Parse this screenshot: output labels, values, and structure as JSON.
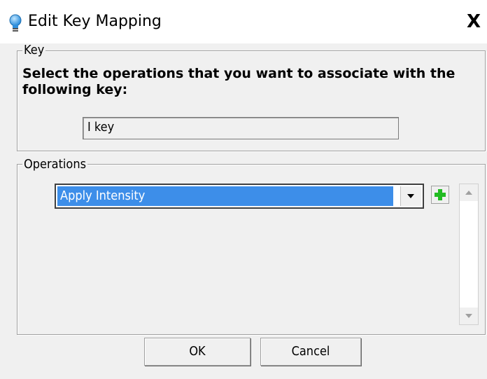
{
  "window": {
    "title": "Edit Key Mapping",
    "icon": "lightbulb-icon",
    "close_label": "X"
  },
  "key_group": {
    "legend": "Key",
    "prompt": "Select the operations that you want to associate with the following key:",
    "key_value": "I key"
  },
  "operations_group": {
    "legend": "Operations",
    "selected_operation": "Apply Intensity",
    "add_icon": "plus-icon"
  },
  "buttons": {
    "ok": "OK",
    "cancel": "Cancel"
  },
  "colors": {
    "selection": "#3d8ee9",
    "add_icon": "#22bb22",
    "title_icon": "#3aa0e8"
  }
}
